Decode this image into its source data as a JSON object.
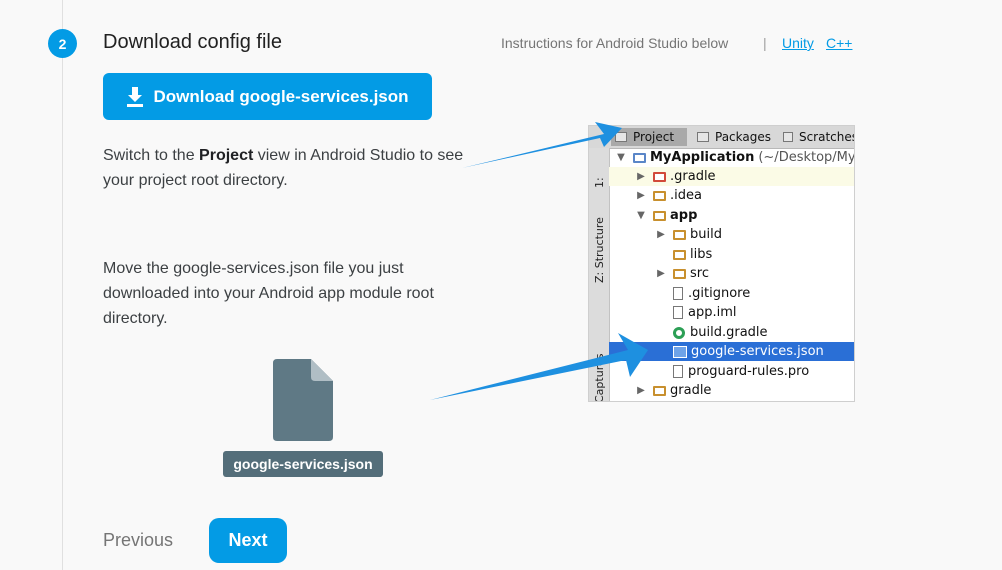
{
  "step": {
    "number": "2",
    "title": "Download config file"
  },
  "header": {
    "instructions": "Instructions for Android Studio below",
    "separator": "|",
    "links": {
      "unity": "Unity",
      "cpp": "C++"
    }
  },
  "download_button": {
    "label": "Download google-services.json"
  },
  "paragraph1": {
    "before": "Switch to the ",
    "bold": "Project",
    "after": " view in Android Studio to see your project root directory."
  },
  "paragraph2": {
    "text": "Move the google-services.json file you just downloaded into your Android app module root directory."
  },
  "file": {
    "label": "google-services.json"
  },
  "nav": {
    "previous": "Previous",
    "next": "Next"
  },
  "ide": {
    "tabs": [
      "Project",
      "Packages",
      "Scratches"
    ],
    "side_labels": [
      "1:",
      "Z: Structure",
      "Captures"
    ],
    "tree": [
      {
        "label": "MyApplication",
        "suffix": "(~/Desktop/My",
        "arrow": "▼",
        "icon": "project-folder-icon"
      },
      {
        "label": ".gradle",
        "arrow": "▶",
        "icon": "folder-icon"
      },
      {
        "label": ".idea",
        "arrow": "▶",
        "icon": "folder-icon"
      },
      {
        "label": "app",
        "arrow": "▼",
        "icon": "module-folder-icon"
      },
      {
        "label": "build",
        "arrow": "▶",
        "icon": "folder-icon"
      },
      {
        "label": "libs",
        "arrow": "",
        "icon": "folder-icon"
      },
      {
        "label": "src",
        "arrow": "▶",
        "icon": "folder-icon"
      },
      {
        "label": ".gitignore",
        "arrow": "",
        "icon": "file-icon"
      },
      {
        "label": "app.iml",
        "arrow": "",
        "icon": "file-icon"
      },
      {
        "label": "build.gradle",
        "arrow": "",
        "icon": "gradle-icon"
      },
      {
        "label": "google-services.json",
        "arrow": "",
        "icon": "json-file-icon"
      },
      {
        "label": "proguard-rules.pro",
        "arrow": "",
        "icon": "file-icon"
      },
      {
        "label": "gradle",
        "arrow": "▶",
        "icon": "folder-icon"
      }
    ]
  },
  "colors": {
    "accent": "#039be5",
    "file_label_bg": "#546e7a",
    "selection": "#2a6fd6",
    "arrow": "#1e90e0"
  }
}
